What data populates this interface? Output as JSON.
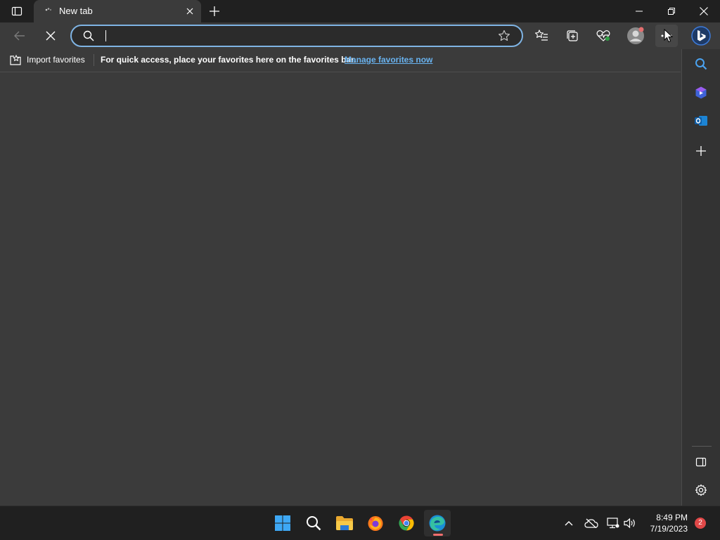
{
  "window": {
    "tab": {
      "title": "New tab"
    }
  },
  "toolbar": {
    "address_value": "",
    "address_placeholder": ""
  },
  "favorites_bar": {
    "import_label": "Import favorites",
    "message": "For quick access, place your favorites here on the favorites bar.",
    "manage_link": "Manage favorites now"
  },
  "taskbar": {
    "apps": [
      "start",
      "search",
      "file-explorer",
      "firefox",
      "chrome",
      "edge"
    ],
    "active_app": "edge",
    "time": "8:49 PM",
    "date": "7/19/2023",
    "notification_count": "2"
  },
  "colors": {
    "accent": "#7fb4e4",
    "link": "#69b3f0",
    "background": "#3b3b3b",
    "titlebar": "#202020"
  }
}
